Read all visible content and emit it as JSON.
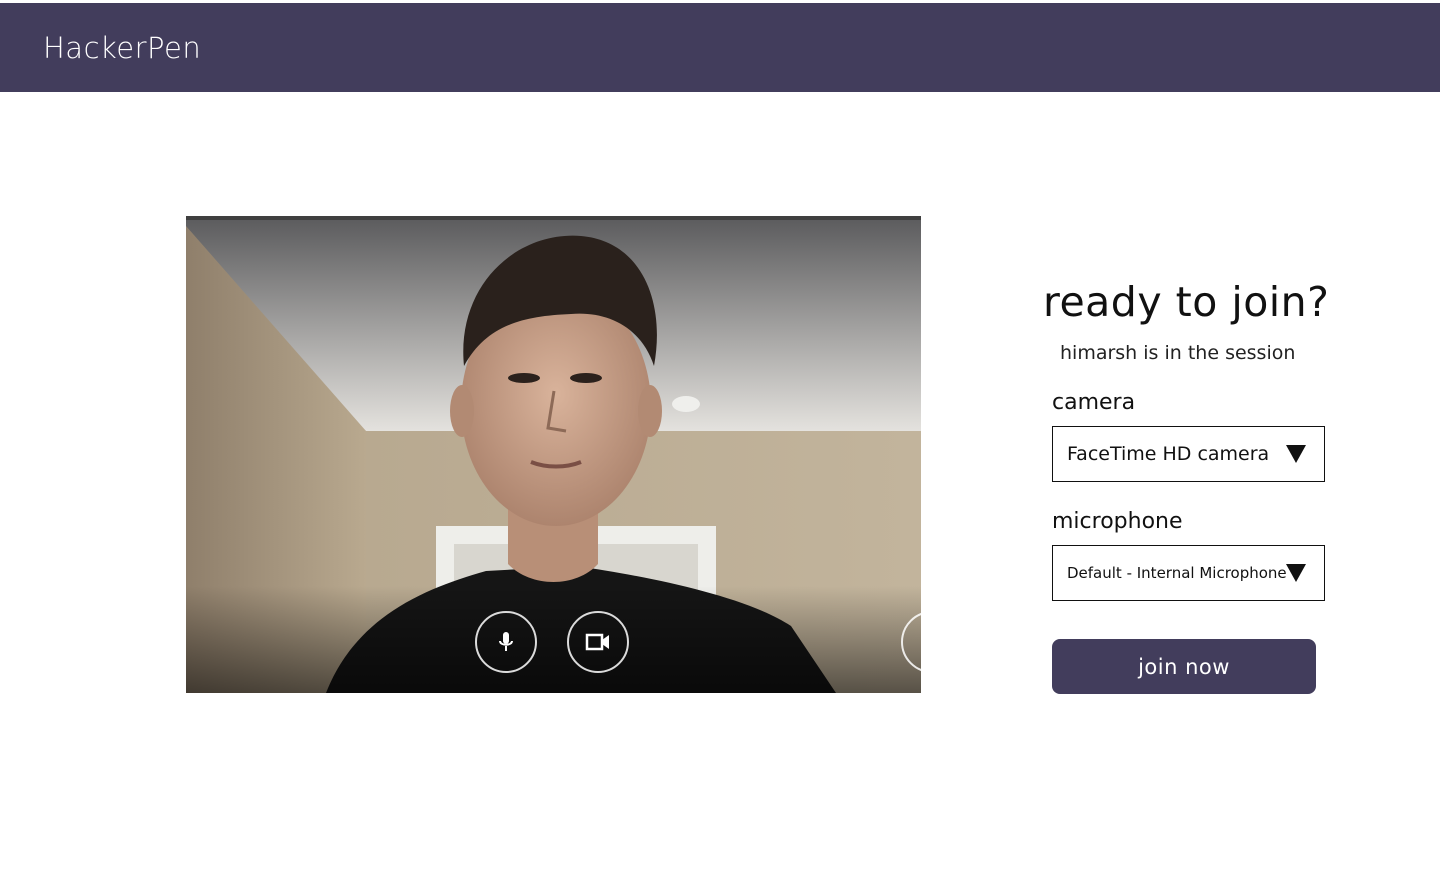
{
  "header": {
    "brand": "HackerPen"
  },
  "preview": {
    "controls": [
      {
        "name": "microphone-toggle",
        "icon": "microphone-icon"
      },
      {
        "name": "camera-toggle",
        "icon": "video-camera-icon"
      }
    ]
  },
  "join_panel": {
    "title": "ready to join?",
    "subtitle": "himarsh is in the session",
    "camera_label": "camera",
    "camera_value": "FaceTime HD camera",
    "microphone_label": "microphone",
    "microphone_value": "Default - Internal Microphone",
    "join_label": "join now"
  },
  "colors": {
    "brand_bar": "#423d5c",
    "join_button": "#423d5c",
    "page_background": "#ffffff"
  }
}
